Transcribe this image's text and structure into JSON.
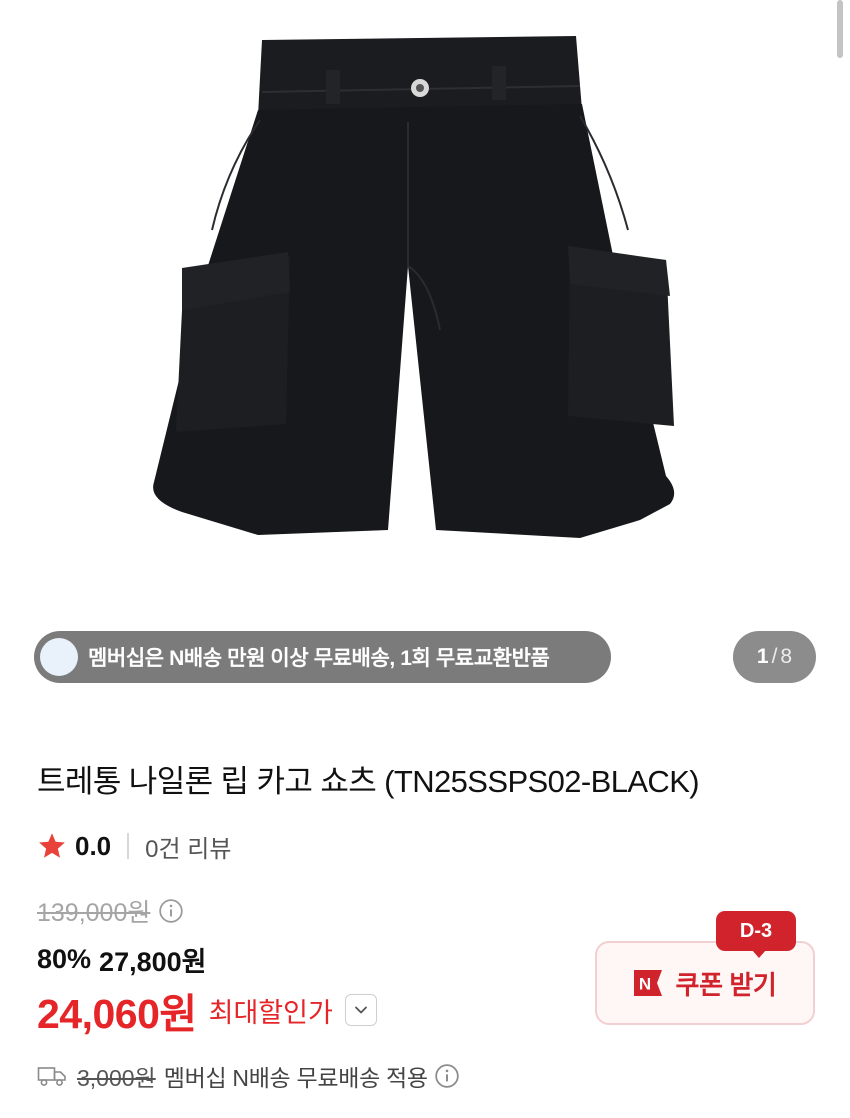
{
  "gallery": {
    "promo_text": "멤버십은 N배송 만원 이상 무료배송, 1회 무료교환반품",
    "counter": {
      "current": "1",
      "separator": "/",
      "total": "8"
    }
  },
  "product": {
    "title": "트레통 나일론 립 카고 쇼츠 (TN25SSPS02-BLACK)",
    "rating": "0.0",
    "review_count": "0건 리뷰"
  },
  "price": {
    "original": "139,000원",
    "discount_rate": "80%",
    "discounted": "27,800원",
    "final": "24,060원",
    "final_label": "최대할인가"
  },
  "coupon": {
    "badge": "D-3",
    "label": "쿠폰 받기",
    "logo_letter": "N"
  },
  "shipping": {
    "fee": "3,000원",
    "text": "멤버십 N배송 무료배송 적용"
  },
  "colors": {
    "sale_red": "#e52528",
    "coupon_red": "#d0232c",
    "star": "#e9423a",
    "pill_gray": "#7b7b7b"
  },
  "icons": [
    "star-icon",
    "info-icon",
    "chevron-down-icon",
    "truck-icon",
    "n-logo-icon"
  ]
}
